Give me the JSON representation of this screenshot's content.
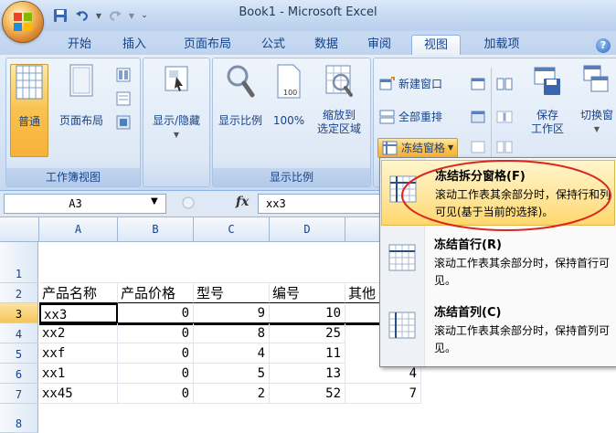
{
  "window": {
    "title": "Book1 - Microsoft Excel"
  },
  "tabs": [
    {
      "label": "开始"
    },
    {
      "label": "插入"
    },
    {
      "label": "页面布局"
    },
    {
      "label": "公式"
    },
    {
      "label": "数据"
    },
    {
      "label": "审阅"
    },
    {
      "label": "视图"
    },
    {
      "label": "加载项"
    }
  ],
  "active_tab": "视图",
  "ribbon": {
    "workbook_views": {
      "label": "工作簿视图",
      "normal": "普通",
      "page_layout": "页面布局"
    },
    "show_hide": {
      "label": "显示/隐藏"
    },
    "zoom": {
      "label": "显示比例",
      "zoom_btn": "显示比例",
      "zoom100": "100%",
      "zoom_sel_line1": "缩放到",
      "zoom_sel_line2": "选定区域",
      "icon100": "100"
    },
    "window": {
      "new_window": "新建窗口",
      "arrange_all": "全部重排",
      "freeze_panes": "冻结窗格",
      "save_ws_line1": "保存",
      "save_ws_line2": "工作区",
      "switch_window": "切换窗"
    }
  },
  "formula_bar": {
    "name_box": "A3",
    "fx": "fx",
    "value": "xx3"
  },
  "columns": [
    "A",
    "B",
    "C",
    "D"
  ],
  "rows": [
    "1",
    "2",
    "3",
    "4",
    "5",
    "6",
    "7",
    "8"
  ],
  "header_row": [
    "产品名称",
    "产品价格",
    "型号",
    "编号",
    "其他"
  ],
  "data_rows": [
    {
      "a": "xx3",
      "b": "0",
      "c": "9",
      "d": "10"
    },
    {
      "a": "xx2",
      "b": "0",
      "c": "8",
      "d": "25"
    },
    {
      "a": "xxf",
      "b": "0",
      "c": "4",
      "d": "11"
    },
    {
      "a": "xx1",
      "b": "0",
      "c": "5",
      "d": "13",
      "e": "4"
    },
    {
      "a": "xx45",
      "b": "0",
      "c": "2",
      "d": "52",
      "e": "7"
    }
  ],
  "freeze_menu": [
    {
      "title": "冻结拆分窗格(F)",
      "desc": "滚动工作表其余部分时，保持行和列可见(基于当前的选择)。"
    },
    {
      "title": "冻结首行(R)",
      "desc": "滚动工作表其余部分时，保持首行可见。"
    },
    {
      "title": "冻结首列(C)",
      "desc": "滚动工作表其余部分时，保持首列可见。"
    }
  ],
  "colors": {
    "ribbon_blue": "#15428b",
    "highlight": "#ffd86b",
    "annotation": "#d9281f"
  }
}
